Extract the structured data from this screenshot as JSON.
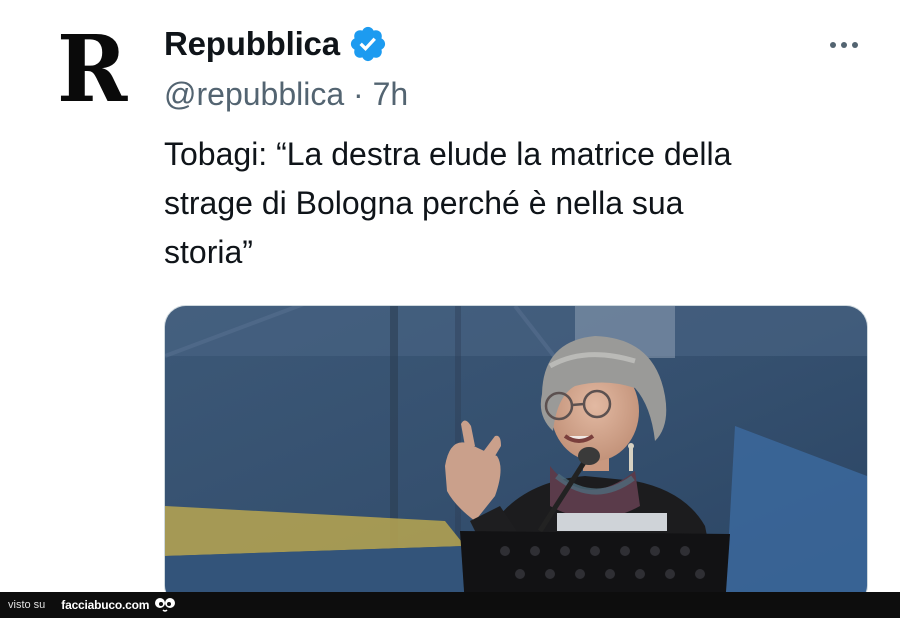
{
  "tweet": {
    "avatar_letter": "R",
    "display_name": "Repubblica",
    "handle": "@repubblica",
    "separator": " · ",
    "time": "7h",
    "text": "Tobagi: “La destra elude la matrice della\nstrage di Bologna perché è nella sua\nstoria”"
  },
  "icons": {
    "verified": "verified-badge-icon",
    "more": "more-options-icon"
  },
  "colors": {
    "verified_blue": "#1d9bf0",
    "secondary_text": "#536471"
  },
  "footer": {
    "prefix": "visto su",
    "site": "facciabuco.com"
  }
}
